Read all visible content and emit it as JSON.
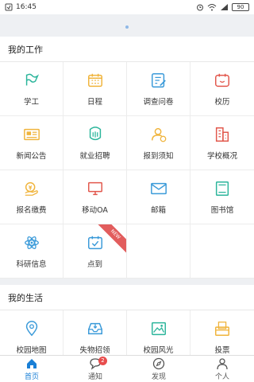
{
  "status_bar": {
    "time": "16:45",
    "battery": "90"
  },
  "work_section": {
    "title": "我的工作",
    "items": [
      {
        "label": "学工",
        "icon": "flag-icon",
        "color": "#2bb59b"
      },
      {
        "label": "日程",
        "icon": "calendar-icon",
        "color": "#f0b43c"
      },
      {
        "label": "调查问卷",
        "icon": "survey-icon",
        "color": "#3a9ad9"
      },
      {
        "label": "校历",
        "icon": "school-calendar-icon",
        "color": "#e2574c"
      },
      {
        "label": "新闻公告",
        "icon": "news-icon",
        "color": "#f0b43c"
      },
      {
        "label": "就业招聘",
        "icon": "recruit-icon",
        "color": "#2bb59b"
      },
      {
        "label": "报到须知",
        "icon": "user-notice-icon",
        "color": "#f0b43c"
      },
      {
        "label": "学校概况",
        "icon": "building-icon",
        "color": "#e2574c"
      },
      {
        "label": "报名缴费",
        "icon": "payment-icon",
        "color": "#f0b43c"
      },
      {
        "label": "移动OA",
        "icon": "monitor-icon",
        "color": "#e2574c"
      },
      {
        "label": "邮箱",
        "icon": "mail-icon",
        "color": "#3a9ad9"
      },
      {
        "label": "图书馆",
        "icon": "book-icon",
        "color": "#2bb59b"
      },
      {
        "label": "科研信息",
        "icon": "atom-icon",
        "color": "#3a9ad9"
      },
      {
        "label": "点到",
        "icon": "checkin-icon",
        "color": "#3a9ad9",
        "ribbon": "NEW"
      }
    ]
  },
  "life_section": {
    "title": "我的生活",
    "items": [
      {
        "label": "校园地图",
        "icon": "map-pin-icon",
        "color": "#3a9ad9"
      },
      {
        "label": "失物招领",
        "icon": "inbox-icon",
        "color": "#3a9ad9"
      },
      {
        "label": "校园风光",
        "icon": "image-icon",
        "color": "#2bb59b"
      },
      {
        "label": "投票",
        "icon": "vote-icon",
        "color": "#f0b43c"
      }
    ]
  },
  "bottom_nav": {
    "items": [
      {
        "label": "首页",
        "icon": "home-icon",
        "active": true
      },
      {
        "label": "通知",
        "icon": "chat-icon",
        "badge": "2"
      },
      {
        "label": "发现",
        "icon": "compass-icon"
      },
      {
        "label": "个人",
        "icon": "person-icon"
      }
    ]
  },
  "colors": {
    "accent": "#1a7fd6",
    "badge": "#e84d4d"
  }
}
